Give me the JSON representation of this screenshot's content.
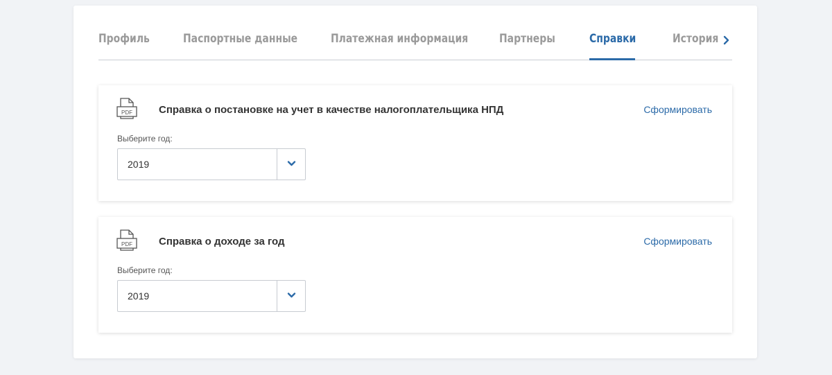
{
  "tabs": {
    "items": [
      {
        "label": "Профиль"
      },
      {
        "label": "Паспортные данные"
      },
      {
        "label": "Платежная информация"
      },
      {
        "label": "Партнеры"
      },
      {
        "label": "Справки"
      },
      {
        "label": "История"
      }
    ],
    "active_index": 4,
    "next_icon": "chevron-right-icon"
  },
  "cards": [
    {
      "icon": "pdf-file-icon",
      "title": "Справка о постановке на учет в качестве налогоплательщика НПД",
      "action": "Сформировать",
      "year_label": "Выберите год:",
      "year_value": "2019",
      "dropdown_icon": "chevron-down-icon"
    },
    {
      "icon": "pdf-file-icon",
      "title": "Справка о доходе за год",
      "action": "Сформировать",
      "year_label": "Выберите год:",
      "year_value": "2019",
      "dropdown_icon": "chevron-down-icon"
    }
  ],
  "colors": {
    "accent": "#2b6aa8",
    "inactive_tab": "#9a9a9a",
    "background": "#f1f3f6"
  }
}
